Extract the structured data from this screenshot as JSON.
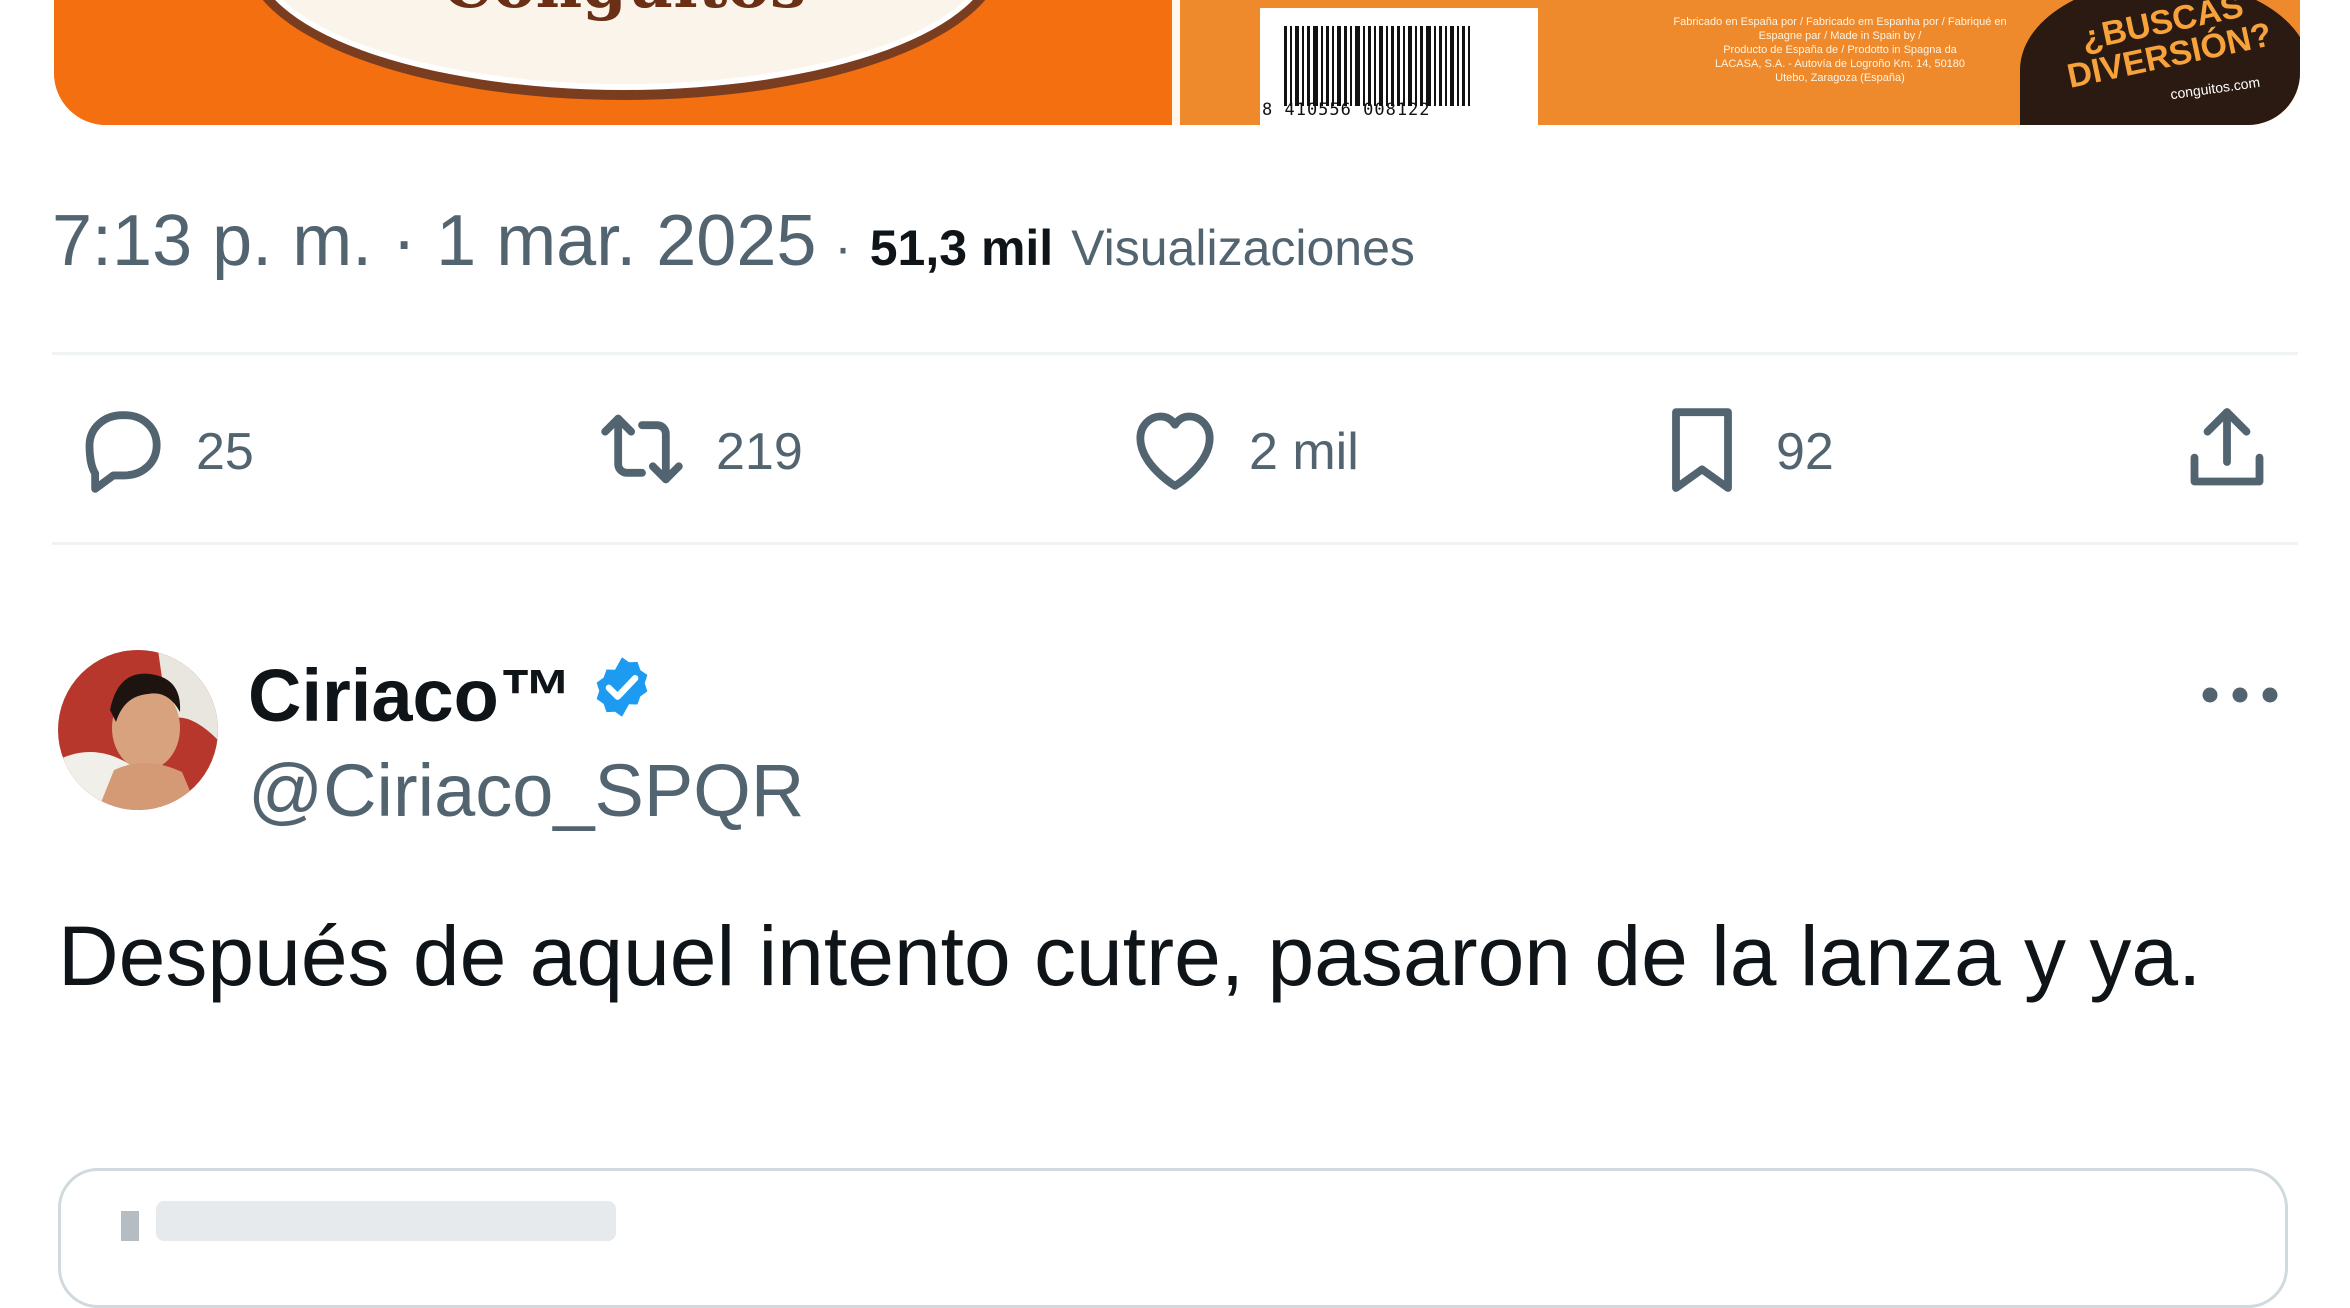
{
  "media": {
    "brand_text": "Conguitos",
    "barcode": "8 410556 008122",
    "fineprint": [
      "Fabricado en España por / Fabricado em Espanha por / Fabriqué en",
      "Espagne par / Made in Spain by /",
      "Producto de España de / Prodotto in Spagna da",
      "LACASA, S.A. - Autovía de Logroño Km. 14, 50180",
      "Utebo, Zaragoza (España)"
    ],
    "badge_line1": "¿BUSCAS",
    "badge_line2": "DIVERSIÓN?",
    "badge_url": "conguitos.com",
    "colors": {
      "orange": "#f46f10",
      "brown": "#6a2f14"
    }
  },
  "meta": {
    "time": "7:13 p. m. · 1 mar. 2025",
    "separator": "·",
    "views_count": "51,3 mil",
    "views_label": "Visualizaciones"
  },
  "actions": {
    "reply": {
      "icon": "comment-icon",
      "count": "25"
    },
    "retweet": {
      "icon": "retweet-icon",
      "count": "219"
    },
    "like": {
      "icon": "heart-icon",
      "count": "2 mil"
    },
    "bookmark": {
      "icon": "bookmark-icon",
      "count": "92"
    },
    "share": {
      "icon": "share-icon"
    }
  },
  "reply": {
    "name": "Ciriaco™",
    "handle": "@Ciriaco_SPQR",
    "verified_color": "#1d9bf0",
    "text": "Después de aquel intento cutre, pasaron de la lanza y ya."
  },
  "theme": {
    "text": "#0f1419",
    "muted": "#536471",
    "divider": "#eff3f4"
  }
}
